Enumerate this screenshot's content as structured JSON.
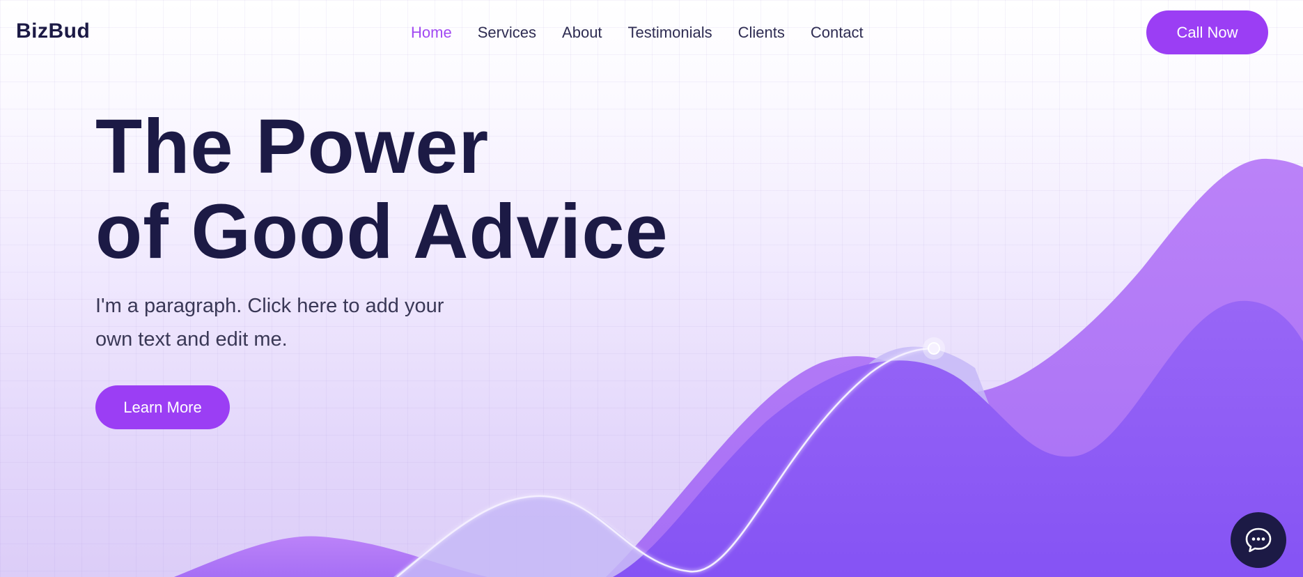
{
  "brand": {
    "name": "BizBud"
  },
  "nav": {
    "items": [
      {
        "label": "Home",
        "active": true
      },
      {
        "label": "Services",
        "active": false
      },
      {
        "label": "About",
        "active": false
      },
      {
        "label": "Testimonials",
        "active": false
      },
      {
        "label": "Clients",
        "active": false
      },
      {
        "label": "Contact",
        "active": false
      }
    ]
  },
  "header": {
    "call_label": "Call Now"
  },
  "hero": {
    "title_line1": "The Power",
    "title_line2": "of Good Advice",
    "paragraph": "I'm a paragraph. Click here to add your own text and edit me.",
    "cta_label": "Learn More"
  },
  "chat": {
    "icon": "chat-bubble-icon"
  },
  "colors": {
    "accent": "#9b3ef4",
    "nav_active": "#a149f2",
    "heading": "#1c1a45",
    "wave_light": "#b57cf7",
    "wave_dark": "#8a57f5"
  }
}
